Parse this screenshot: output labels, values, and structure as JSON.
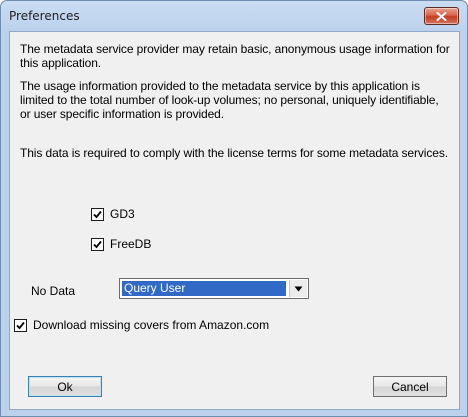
{
  "window": {
    "title": "Preferences"
  },
  "info": {
    "paragraph1": "The metadata service provider may retain basic, anonymous usage information for this application.",
    "paragraph2": "The usage information provided to the metadata service by this application is limited to the total number of look-up volumes; no personal, uniquely identifiable, or user specific information is provided.",
    "paragraph3": "This data is required to comply with the license terms for some metadata services."
  },
  "services": {
    "gd3": {
      "label": "GD3",
      "checked": true
    },
    "freedb": {
      "label": "FreeDB",
      "checked": true
    }
  },
  "no_data": {
    "label": "No Data",
    "selected": "Query User"
  },
  "amazon": {
    "label": "Download missing covers from Amazon.com",
    "checked": true
  },
  "buttons": {
    "ok": "Ok",
    "cancel": "Cancel"
  },
  "icons": {
    "close": "close-icon",
    "check": "checkmark-icon",
    "dropdown": "chevron-down-icon"
  }
}
